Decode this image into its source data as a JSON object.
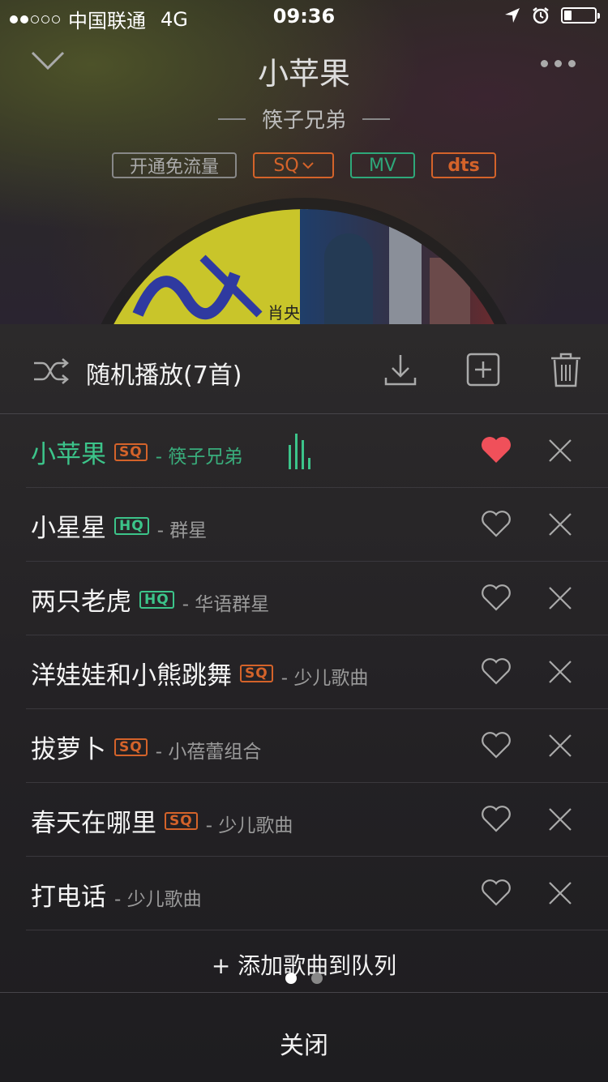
{
  "status_bar": {
    "signal_dots_filled": 2,
    "signal_dots_total": 5,
    "carrier": "中国联通",
    "network": "4G",
    "time": "09:36",
    "battery_level": 0.25
  },
  "player": {
    "title": "小苹果",
    "artist": "筷子兄弟",
    "badges": {
      "free_traffic": "开通免流量",
      "quality": "SQ",
      "mv": "MV",
      "dts": "dts"
    },
    "album_art_text": "肖央"
  },
  "queue": {
    "mode_label": "随机播放(7首)",
    "songs": [
      {
        "name": "小苹果",
        "quality": "SQ",
        "artist": "- 筷子兄弟",
        "liked": true,
        "playing": true
      },
      {
        "name": "小星星",
        "quality": "HQ",
        "artist": "- 群星",
        "liked": false
      },
      {
        "name": "两只老虎",
        "quality": "HQ",
        "artist": "- 华语群星",
        "liked": false
      },
      {
        "name": "洋娃娃和小熊跳舞",
        "quality": "SQ",
        "artist": "- 少儿歌曲",
        "liked": false
      },
      {
        "name": "拔萝卜",
        "quality": "SQ",
        "artist": "- 小蓓蕾组合",
        "liked": false
      },
      {
        "name": "春天在哪里",
        "quality": "SQ",
        "artist": "- 少儿歌曲",
        "liked": false
      },
      {
        "name": "打电话",
        "quality": "",
        "artist": "- 少儿歌曲",
        "liked": false
      }
    ],
    "add_label": "+ 添加歌曲到队列",
    "close_label": "关闭",
    "page_count": 2,
    "current_page": 1
  },
  "colors": {
    "accent_green": "#3cc48a",
    "sq_orange": "#d4632a",
    "heart_red": "#f0505a"
  }
}
